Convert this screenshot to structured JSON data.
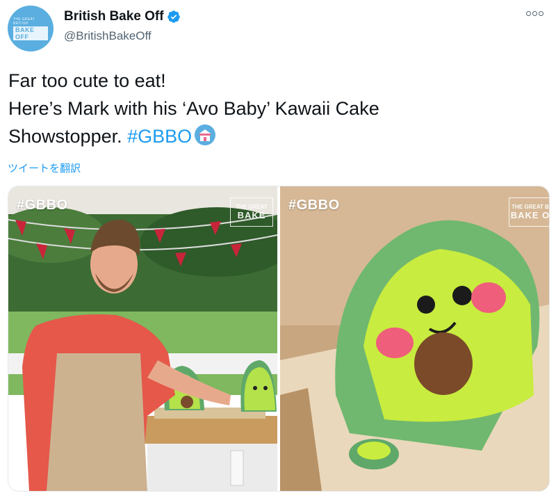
{
  "tweet": {
    "display_name": "British Bake Off",
    "handle": "@BritishBakeOff",
    "avatar_text_line1": "THE GREAT BRITISH",
    "avatar_text_line2": "BAKE OFF",
    "text_lines": [
      "Far too cute to eat!",
      "Here’s Mark with his ‘Avo Baby’ Kawaii Cake",
      "Showstopper."
    ],
    "hashtag": "#GBBO",
    "translate_label": "ツイートを翻訳"
  },
  "media": {
    "left_tag": "#GBBO",
    "right_tag": "#GBBO",
    "left_watermark": [
      "THE GREAT",
      "BAKE"
    ],
    "right_watermark": [
      "THE GREAT B",
      "BAKE O"
    ]
  },
  "colors": {
    "link": "#1d9bf0",
    "verified": "#1d9bf0",
    "avatar_bg": "#5aaee0"
  }
}
